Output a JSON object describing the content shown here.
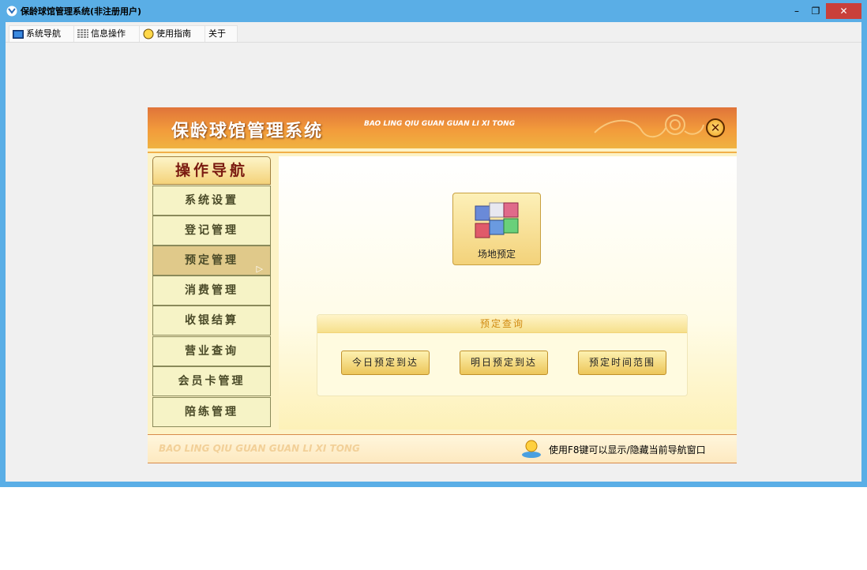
{
  "window": {
    "title": "保龄球馆管理系统(非注册用户)",
    "minimize": "–",
    "maximize": "❐",
    "close": "✕"
  },
  "menu": [
    {
      "label": "系统导航",
      "icon": "monitor-icon"
    },
    {
      "label": "信息操作",
      "icon": "grid-icon"
    },
    {
      "label": "使用指南",
      "icon": "smiley-icon"
    },
    {
      "label": "关于",
      "icon": ""
    }
  ],
  "banner": {
    "title": "保龄球馆管理系统",
    "pinyin": "BAO LING QIU GUAN GUAN LI XI TONG",
    "close": "✕"
  },
  "nav": {
    "header": "操作导航",
    "items": [
      "系统设置",
      "登记管理",
      "预定管理",
      "消费管理",
      "收银结算",
      "营业查询",
      "会员卡管理",
      "陪练管理"
    ],
    "active": "预定管理"
  },
  "content": {
    "tile_label": "场地预定",
    "query_title": "预定查询",
    "buttons": [
      "今日预定到达",
      "明日预定到达",
      "预定时间范围"
    ]
  },
  "footer": {
    "pinyin": "BAO LING QIU GUAN GUAN LI XI TONG",
    "tip": "使用F8键可以显示/隐藏当前导航窗口"
  },
  "colors": {
    "titlebar": "#5aaee6",
    "banner": "#f29b3b",
    "panel": "#fdf3c6",
    "close_button": "#c9403a"
  }
}
